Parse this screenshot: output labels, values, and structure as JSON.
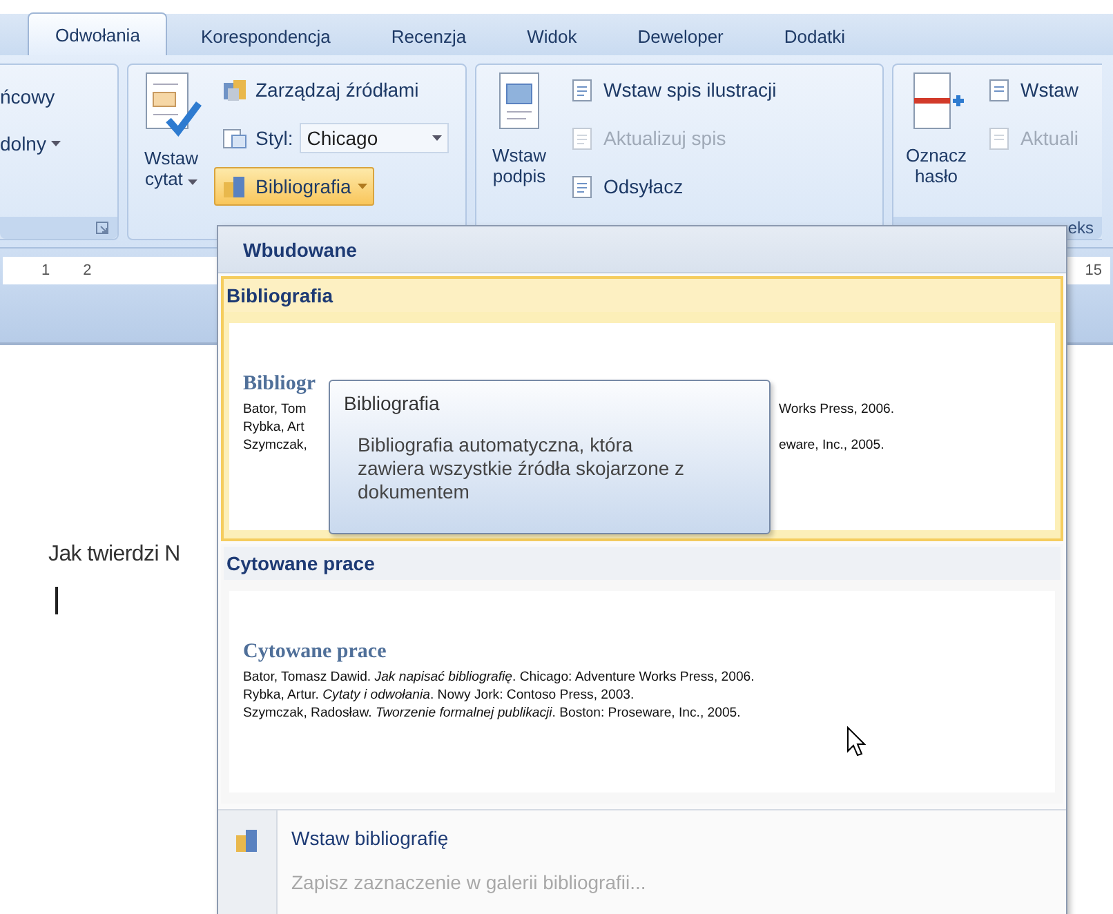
{
  "tabs": [
    {
      "label": "Odwołania",
      "selected": true
    },
    {
      "label": "Korespondencja",
      "selected": false
    },
    {
      "label": "Recenzja",
      "selected": false
    },
    {
      "label": "Widok",
      "selected": false
    },
    {
      "label": "Deweloper",
      "selected": false
    },
    {
      "label": "Dodatki",
      "selected": false
    }
  ],
  "ribbon": {
    "group_1": {
      "lines": [
        {
          "label": "ńcowy",
          "dropdown": false
        },
        {
          "label": "dolny",
          "dropdown": true
        }
      ]
    },
    "group_2": {
      "insert_citation": {
        "label": "Wstaw cytat",
        "dropdown": true
      },
      "manage_sources": "Zarządzaj źródłami",
      "style_label": "Styl:",
      "style_value": "Chicago",
      "bibliography": {
        "label": "Bibliografia",
        "pressed": true
      }
    },
    "group_3": {
      "insert_caption": "Wstaw podpis",
      "small": [
        {
          "label": "Wstaw spis ilustracji",
          "disabled": false
        },
        {
          "label": "Aktualizuj spis",
          "disabled": true
        },
        {
          "label": "Odsyłacz",
          "disabled": false
        }
      ]
    },
    "group_4": {
      "mark_entry": "Oznacz hasło",
      "small": [
        {
          "label": "Wstaw",
          "disabled": false
        },
        {
          "label": "Aktuali",
          "disabled": true
        }
      ],
      "group_label": "eks"
    }
  },
  "ruler": {
    "left_numbers": [
      "1",
      "2"
    ],
    "right_numbers": [
      "15"
    ]
  },
  "document": {
    "text": "Jak twierdzi N"
  },
  "dropdown": {
    "header": "Wbudowane",
    "items": [
      {
        "title": "Bibliografia",
        "selected": true,
        "preview_heading": "Bibliogr",
        "preview_lines": [
          {
            "left": "Bator, Tom",
            "right": "Works Press, 2006."
          },
          {
            "left": "Rybka, Art"
          },
          {
            "left": "Szymczak,",
            "right": "eware, Inc., 2005."
          }
        ]
      },
      {
        "title": "Cytowane prace",
        "selected": false,
        "preview_heading": "Cytowane prace",
        "preview_lines": [
          {
            "left": "Bator, Tomasz Dawid. *Jak napisać bibliografię*. Chicago: Adventure Works Press, 2006."
          },
          {
            "left": "Rybka, Artur. *Cytaty i odwołania*. Nowy Jork: Contoso Press, 2003."
          },
          {
            "left": "Szymczak, Radosław. *Tworzenie formalnej publikacji*. Boston: Proseware, Inc., 2005."
          }
        ]
      }
    ],
    "commands": [
      {
        "label": "Wstaw bibliografię",
        "disabled": false
      },
      {
        "label": "Zapisz zaznaczenie w galerii bibliografii...",
        "disabled": true
      }
    ]
  },
  "tooltip": {
    "title": "Bibliografia",
    "text": "Bibliografia automatyczna, która zawiera wszystkie źródła skojarzone z dokumentem"
  }
}
